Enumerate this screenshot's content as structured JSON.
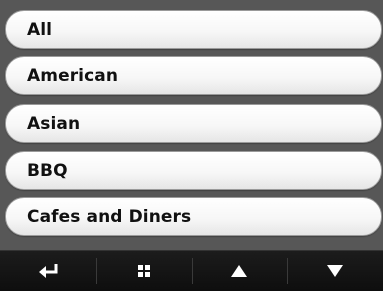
{
  "categories": [
    {
      "label": "All"
    },
    {
      "label": "American"
    },
    {
      "label": "Asian"
    },
    {
      "label": "BBQ"
    },
    {
      "label": "Cafes and Diners"
    }
  ],
  "toolbar": {
    "buttons": [
      {
        "icon": "back-arrow-icon"
      },
      {
        "icon": "grid-menu-icon"
      },
      {
        "icon": "scroll-up-icon"
      },
      {
        "icon": "scroll-down-icon"
      }
    ]
  },
  "colors": {
    "background": "#555555",
    "toolbar": "#141414",
    "item_text": "#111111",
    "icon": "#ffffff"
  }
}
